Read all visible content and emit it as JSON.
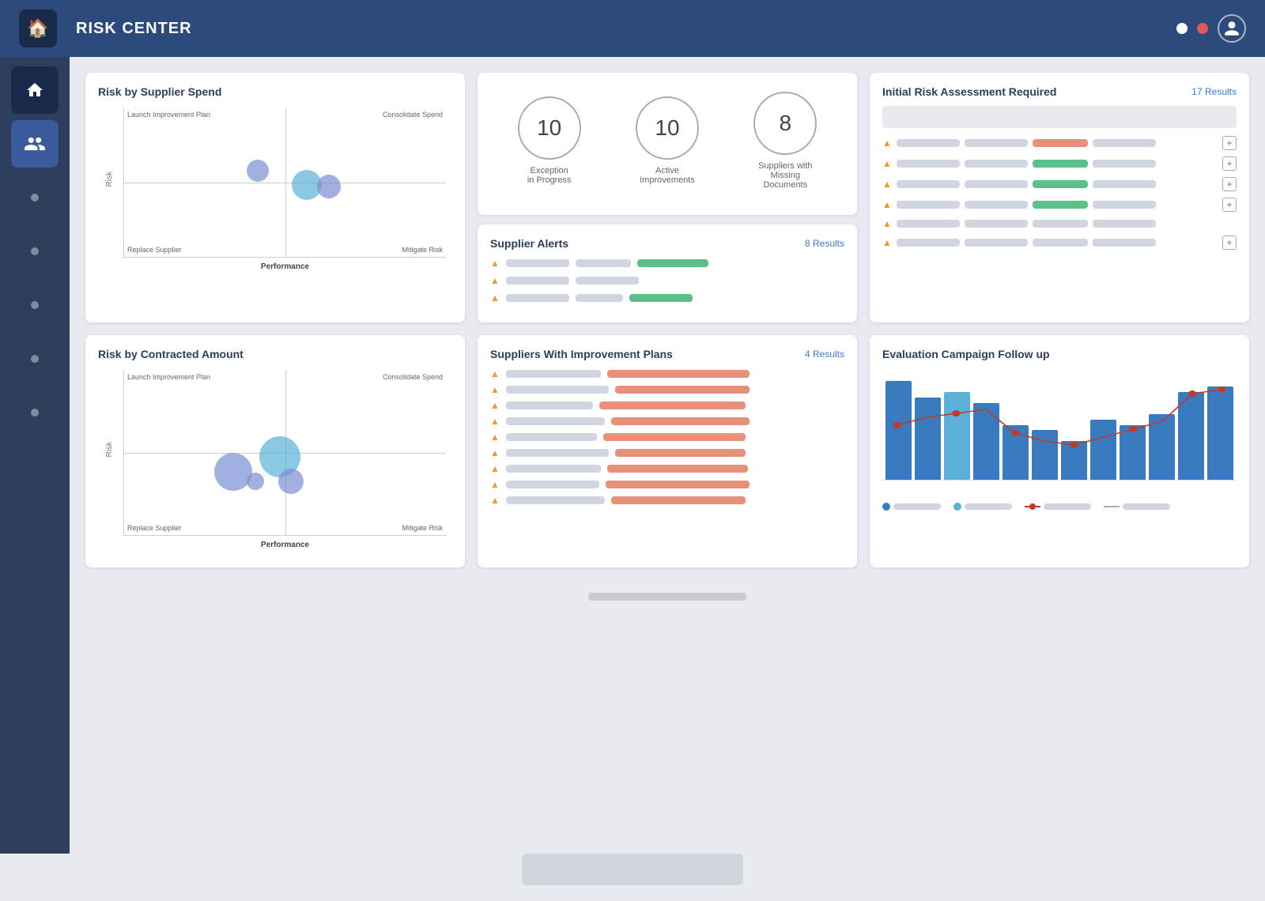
{
  "header": {
    "title": "RISK CENTER",
    "icons": {
      "dot1": "⚪",
      "dot2": "🔴",
      "avatar": "👤"
    }
  },
  "sidebar": {
    "items": [
      {
        "label": "home",
        "icon": "🏠",
        "active": false,
        "home": true
      },
      {
        "label": "people-group",
        "icon": "👥",
        "active": true
      },
      {
        "label": "circle1",
        "icon": "●",
        "active": false
      },
      {
        "label": "circle2",
        "icon": "●",
        "active": false
      },
      {
        "label": "circle3",
        "icon": "●",
        "active": false
      },
      {
        "label": "circle4",
        "icon": "●",
        "active": false
      },
      {
        "label": "circle5",
        "icon": "●",
        "active": false
      }
    ]
  },
  "cards": {
    "risk_by_supplier_spend": {
      "title": "Risk by Supplier Spend",
      "top_left": "Launch Improvement Plan",
      "top_right": "Consolidate Spend",
      "bottom_left": "Replace Supplier",
      "bottom_right": "Mitigate Risk",
      "x_label": "Performance",
      "y_label": "Risk"
    },
    "stats": {
      "exception": {
        "value": "10",
        "label": "Exception\nin Progress"
      },
      "active": {
        "value": "10",
        "label": "Active\nImprovements"
      },
      "missing": {
        "value": "8",
        "label": "Suppliers with\nMissing\nDocuments"
      }
    },
    "supplier_alerts": {
      "title": "Supplier Alerts",
      "results": "8 Results"
    },
    "initial_risk": {
      "title": "Initial Risk Assessment Required",
      "results": "17 Results"
    },
    "risk_by_contracted": {
      "title": "Risk by Contracted Amount",
      "top_left": "Launch Improvement Plan",
      "top_right": "Consolidate Spend",
      "bottom_left": "Replace Supplier",
      "bottom_right": "Mitigate Risk",
      "x_label": "Performance",
      "y_label": "Risk"
    },
    "improvement_plans": {
      "title": "Suppliers With Improvement Plans",
      "results": "4 Results"
    },
    "evaluation_campaign": {
      "title": "Evaluation Campaign Follow up"
    }
  },
  "colors": {
    "primary": "#2c4a7c",
    "sidebar": "#2c3e5c",
    "accent_blue": "#3a7bd5",
    "green": "#5bbf8a",
    "red": "#e8907a",
    "orange": "#e8a020",
    "teal": "#5cc8c8",
    "chart_blue": "#3a7bbf",
    "chart_blue_light": "#5ab0d8"
  }
}
